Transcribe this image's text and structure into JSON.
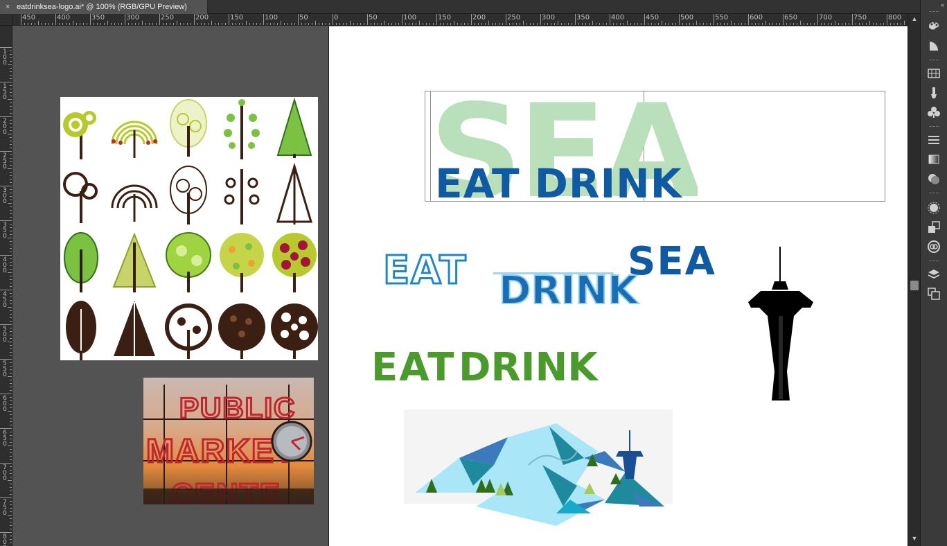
{
  "document": {
    "tab_title": "eatdrinksea-logo.ai* @ 100% (RGB/GPU Preview)",
    "close_glyph": "×"
  },
  "ruler": {
    "horizontal_labels": [
      "450",
      "400",
      "350",
      "300",
      "250",
      "200",
      "150",
      "100",
      "50",
      "0",
      "50",
      "100",
      "150",
      "200",
      "250",
      "300",
      "350",
      "400",
      "450",
      "500",
      "550",
      "600",
      "650",
      "700",
      "750",
      "800"
    ],
    "vertical_labels": [
      "100",
      "150",
      "200",
      "250",
      "300",
      "350",
      "400",
      "450",
      "500",
      "550",
      "600",
      "650",
      "700",
      "750",
      "800"
    ]
  },
  "placed_images": {
    "trees_icon_set": "tree-icons-illustration",
    "pike_place_photo": "public-market-center-sign-photo",
    "mountains_graphic": "mountains-with-space-needle-illustration",
    "space_needle_silhouette": "space-needle-silhouette"
  },
  "artboard_text": {
    "logo_sea": "SEA",
    "logo_eat_drink": "EAT DRINK",
    "outline_eat": "EAT",
    "outline_drink": "DRINK",
    "blue_sea": "SEA",
    "green_eat": "EAT",
    "green_drink": "DRINK"
  },
  "colors": {
    "sea_light_green": "#b9dfbb",
    "blue_primary": "#0f5aa3",
    "outline_blue": "#1f86c8",
    "green_primary": "#4a9a2c",
    "green_bright": "#62c01a"
  },
  "panel_icons": [
    "color-guide-icon",
    "stroke-icon",
    "swatches-icon",
    "brushes-icon",
    "symbols-icon",
    "align-icon",
    "gradient-icon",
    "transparency-icon",
    "appearance-icon",
    "graphic-styles-icon",
    "cc-libraries-icon",
    "layers-icon",
    "artboards-icon"
  ],
  "scrollbar": {
    "up": "▲",
    "down": "▼"
  },
  "panel_collapse": "«"
}
